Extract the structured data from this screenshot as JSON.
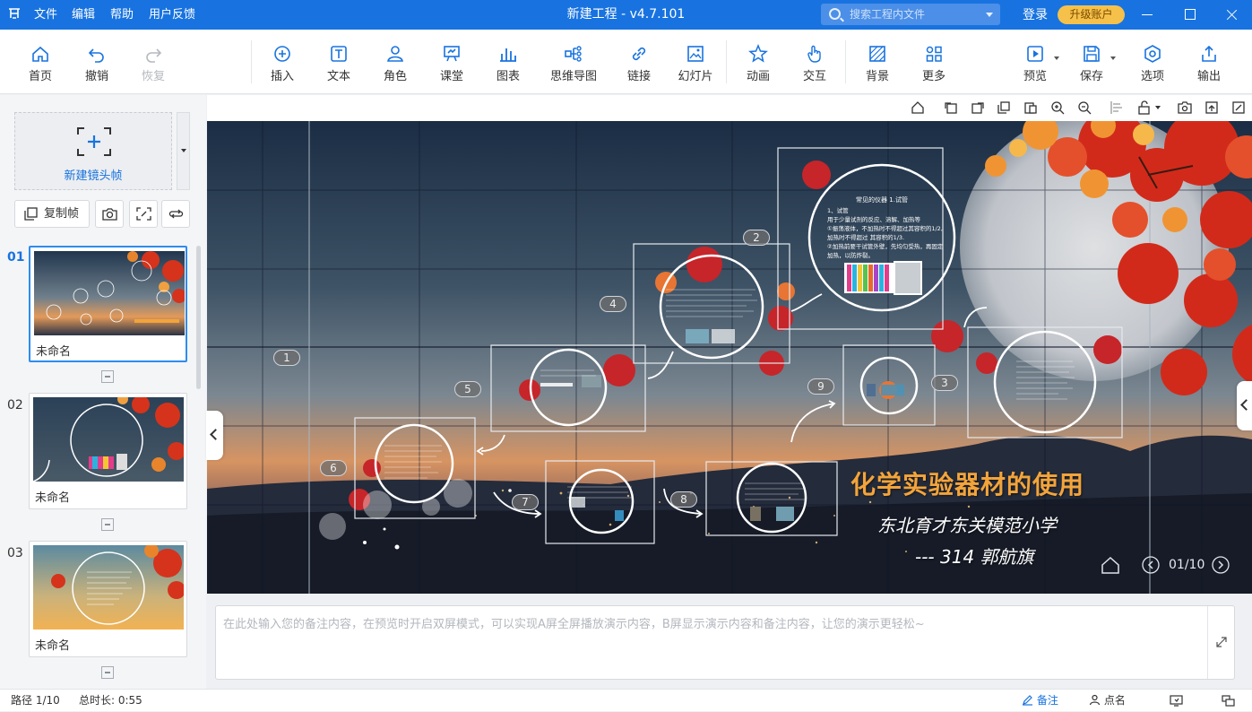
{
  "app": {
    "title": "新建工程 - v4.7.101",
    "menu": [
      "文件",
      "编辑",
      "帮助",
      "用户反馈"
    ],
    "search_placeholder": "搜索工程内文件",
    "login": "登录",
    "upgrade": "升级账户"
  },
  "toolbar": {
    "home": "首页",
    "undo": "撤销",
    "redo": "恢复",
    "insert": "插入",
    "text": "文本",
    "role": "角色",
    "classroom": "课堂",
    "chart": "图表",
    "mindmap": "思维导图",
    "link": "链接",
    "slideshow": "幻灯片",
    "animation": "动画",
    "interaction": "交互",
    "background": "背景",
    "more": "更多",
    "preview": "预览",
    "save": "保存",
    "options": "选项",
    "export": "输出"
  },
  "left_panel": {
    "new_frame": "新建镜头帧",
    "copy_frame": "复制帧",
    "thumbnails": [
      {
        "num": "01",
        "caption": "未命名"
      },
      {
        "num": "02",
        "caption": "未命名"
      },
      {
        "num": "03",
        "caption": "未命名"
      }
    ]
  },
  "canvas": {
    "title": "化学实验器材的使用",
    "subtitle1": "东北育才东关模范小学",
    "subtitle2": "--- 314 郭航旗",
    "page_indicator": "01/10",
    "path_numbers": [
      "1",
      "2",
      "3",
      "4",
      "5",
      "6",
      "7",
      "8",
      "9"
    ],
    "frame_heading": "常见的仪器 1.试管",
    "frame_lines": [
      "1、试管",
      "用于少量试剂的反应、溶解、加热等",
      "①振荡液体，不加热时不得超过其容积的1/2,",
      "加热时不得超过 其容积的1/3.",
      "②加热前要干试管外壁，先均匀受热，再固定",
      "加热，以防炸裂。"
    ]
  },
  "notes": {
    "placeholder": "在此处输入您的备注内容，在预览时开启双屏模式，可以实现A屏全屏播放演示内容，B屏显示演示内容和备注内容，让您的演示更轻松~"
  },
  "status": {
    "path": "路径 1/10",
    "duration": "总时长: 0:55",
    "notes_btn": "备注",
    "rollcall_btn": "点名"
  },
  "colors": {
    "brand": "#1873e0",
    "upgrade": "#f6c14a",
    "title_orange": "#f3a43a"
  }
}
